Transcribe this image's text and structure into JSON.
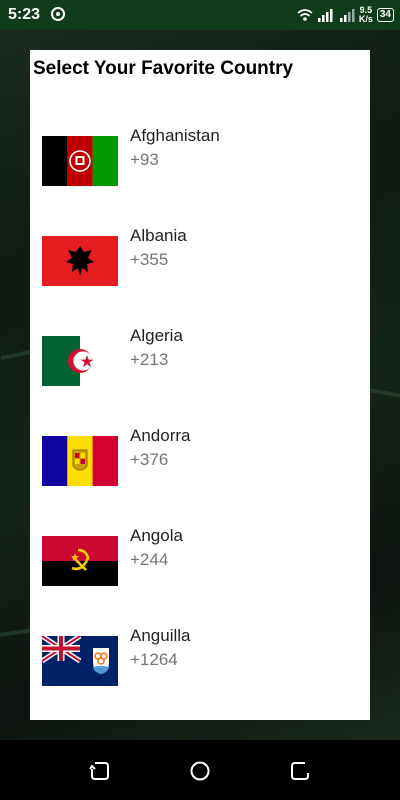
{
  "status_bar": {
    "time": "5:23",
    "net_speed_value": "9.5",
    "net_speed_unit": "K/s",
    "battery": "34",
    "icons": [
      "hotspot-icon",
      "wifi-icon",
      "signal-icon",
      "signal-icon-2",
      "battery-icon"
    ]
  },
  "dialog": {
    "title": "Select Your Favorite Country"
  },
  "countries": [
    {
      "name": "Afghanistan",
      "code": "+93",
      "flag": "afghanistan-flag"
    },
    {
      "name": "Albania",
      "code": "+355",
      "flag": "albania-flag"
    },
    {
      "name": "Algeria",
      "code": "+213",
      "flag": "algeria-flag"
    },
    {
      "name": "Andorra",
      "code": "+376",
      "flag": "andorra-flag"
    },
    {
      "name": "Angola",
      "code": "+244",
      "flag": "angola-flag"
    },
    {
      "name": "Anguilla",
      "code": "+1264",
      "flag": "anguilla-flag"
    }
  ],
  "nav_bar": {
    "icons": [
      "recents-icon",
      "home-icon",
      "back-icon"
    ]
  },
  "colors": {
    "status_bar_bg": "#0f3d1b",
    "dialog_bg": "#ffffff",
    "code_text": "#757575"
  }
}
